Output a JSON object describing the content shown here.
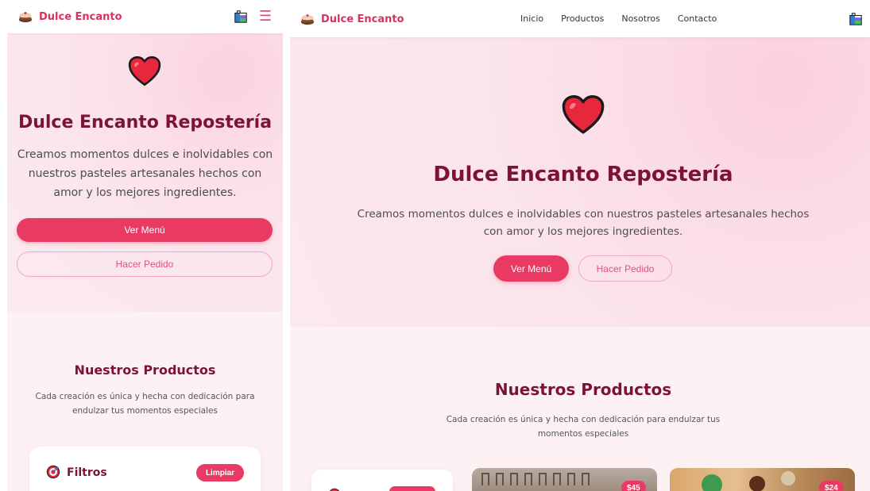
{
  "brand": {
    "name": "Dulce Encanto"
  },
  "nav": {
    "links": [
      "Inicio",
      "Productos",
      "Nosotros",
      "Contacto"
    ]
  },
  "hero": {
    "title": "Dulce Encanto Repostería",
    "description": "Creamos momentos dulces e inolvidables con nuestros pasteles artesanales hechos con amor y los mejores ingredientes.",
    "primary_button": "Ver Menú",
    "secondary_button": "Hacer Pedido"
  },
  "products": {
    "title": "Nuestros Productos",
    "subtitle": "Cada creación es única y hecha con dedicación para endulzar tus momentos especiales",
    "filters_title": "Filtros",
    "clear_button": "Limpiar",
    "cards": [
      {
        "price": "$45"
      },
      {
        "price": "$24"
      }
    ]
  },
  "colors": {
    "accent": "#e83a62",
    "title": "#7e1236",
    "hero_bg": "#fce8ef"
  },
  "icons": [
    "cake-icon",
    "shopping-bag-icon",
    "hamburger-menu-icon",
    "heart-icon",
    "target-icon"
  ]
}
